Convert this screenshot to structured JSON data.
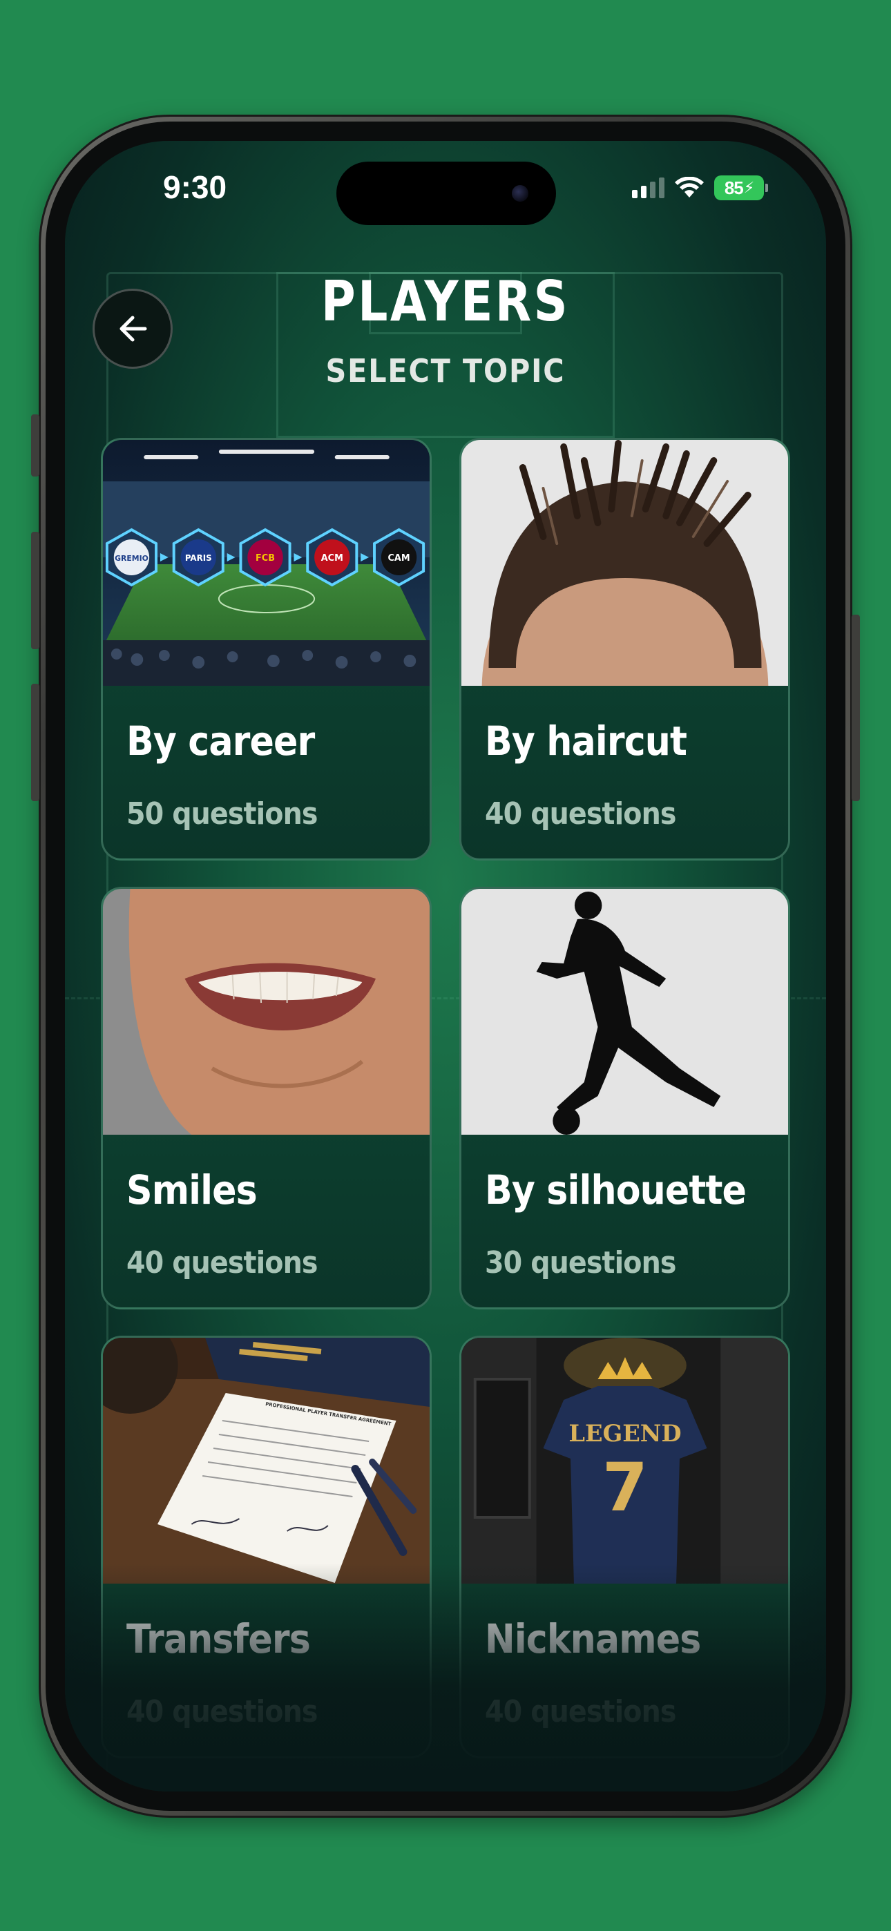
{
  "status_bar": {
    "time": "9:30",
    "battery": "85"
  },
  "header": {
    "title": "PLAYERS",
    "subtitle": "SELECT TOPIC"
  },
  "topics": [
    {
      "label": "By career",
      "count": "50 questions"
    },
    {
      "label": "By haircut",
      "count": "40 questions"
    },
    {
      "label": "Smiles",
      "count": "40 questions"
    },
    {
      "label": "By silhouette",
      "count": "30 questions"
    },
    {
      "label": "Transfers",
      "count": "40 questions"
    },
    {
      "label": "Nicknames",
      "count": "40 questions"
    }
  ],
  "career_badges": [
    "GREMIO",
    "PARIS",
    "FCB",
    "ACM",
    "CAM"
  ],
  "document_heading": "PROFESSIONAL PLAYER TRANSFER AGREEMENT",
  "jersey": {
    "text": "LEGEND",
    "number": "7"
  },
  "icons": {
    "back": "arrow-left-icon",
    "signal": "cellular-signal-icon",
    "wifi": "wifi-icon",
    "battery": "battery-icon"
  },
  "colors": {
    "background": "#218a50",
    "accent_green": "#33c65a",
    "card_bg": "#0f4a35"
  }
}
